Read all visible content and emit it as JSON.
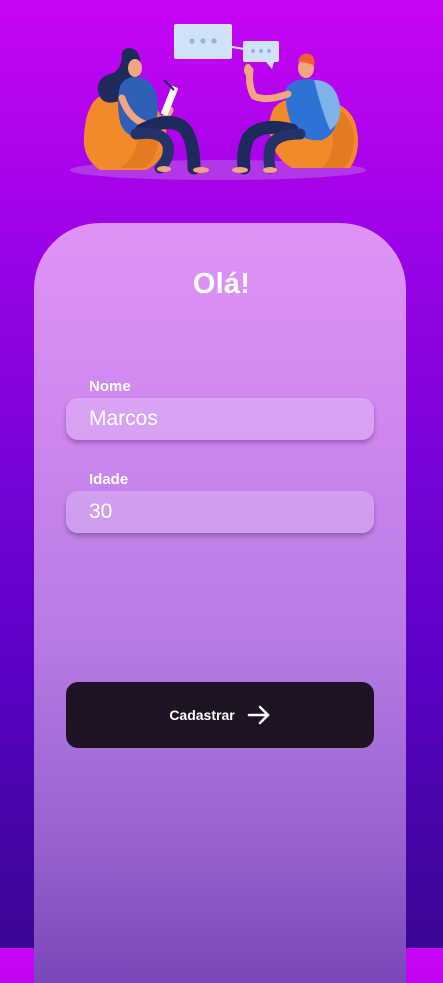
{
  "header": {
    "illustration_icon": "two-people-chatting-illustration"
  },
  "form": {
    "title": "Olá!",
    "name_label": "Nome",
    "name_value": "Marcos",
    "age_label": "Idade",
    "age_value": "30",
    "submit_label": "Cadastrar",
    "submit_icon": "arrow-right-icon"
  },
  "colors": {
    "bg_top": "#c705f5",
    "bg_bottom": "#3a0693",
    "card_top": "#df93f7",
    "button": "#1d1324",
    "text": "#ffffff"
  }
}
